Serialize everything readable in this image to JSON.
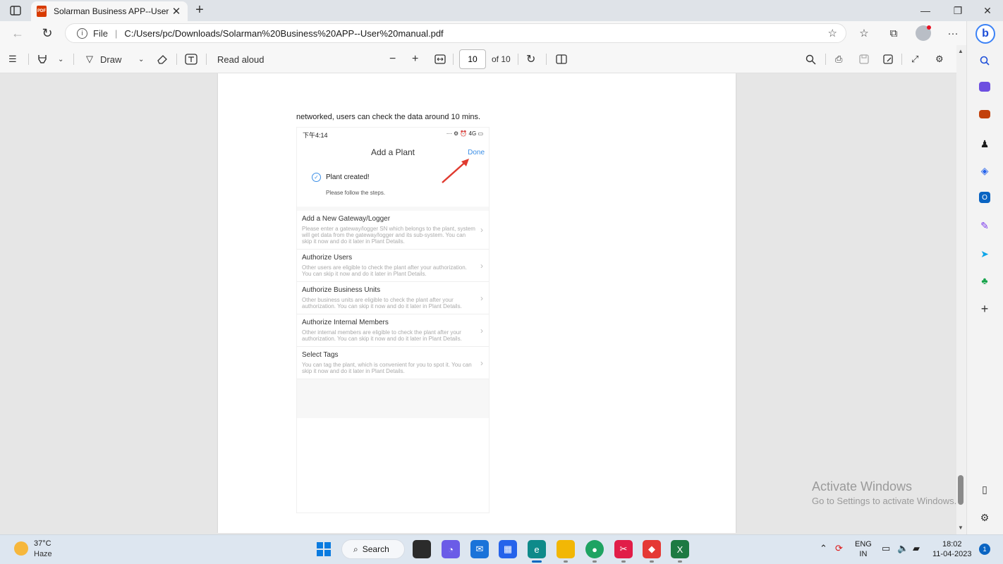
{
  "browser": {
    "tab_title": "Solarman Business APP--User manual.pdf",
    "tab_icon_text": "PDF",
    "file_label": "File",
    "separator": "|",
    "url": "C:/Users/pc/Downloads/Solarman%20Business%20APP--User%20manual.pdf"
  },
  "pdf_toolbar": {
    "draw_label": "Draw",
    "read_aloud_label": "Read aloud",
    "page_number": "10",
    "page_total": "of 10"
  },
  "document": {
    "caption": "networked, users can check the data around 10 mins.",
    "phone": {
      "status_time": "下午4:14",
      "status_right": "··· ⚙ ⏰ 4G ▭",
      "title": "Add a Plant",
      "done": "Done",
      "created": "Plant created!",
      "follow": "Please follow the steps.",
      "items": [
        {
          "title": "Add a New Gateway/Logger",
          "desc": "Please enter a gateway/logger SN which belongs to the plant, system will get data from the gateway/logger and its sub-system. You can skip it now and do it later in Plant Details."
        },
        {
          "title": "Authorize Users",
          "desc": "Other users are eligible to check the plant after your authorization. You can skip it now and do it later in Plant Details."
        },
        {
          "title": "Authorize Business Units",
          "desc": "Other business units are eligible to check the plant after your authorization. You can skip it now and do it later in Plant Details."
        },
        {
          "title": "Authorize Internal Members",
          "desc": "Other internal members are eligible to check the plant after your authorization. You can skip it now and do it later in Plant Details."
        },
        {
          "title": "Select Tags",
          "desc": "You can tag the plant, which is convenient for you to spot it. You can skip it now and do it later in Plant Details."
        }
      ]
    }
  },
  "watermark": {
    "line1": "Activate Windows",
    "line2": "Go to Settings to activate Windows."
  },
  "taskbar": {
    "temperature": "37°C",
    "weather": "Haze",
    "search_label": "Search",
    "lang_line1": "ENG",
    "lang_line2": "IN",
    "time": "18:02",
    "date": "11-04-2023",
    "notification_count": "1"
  }
}
